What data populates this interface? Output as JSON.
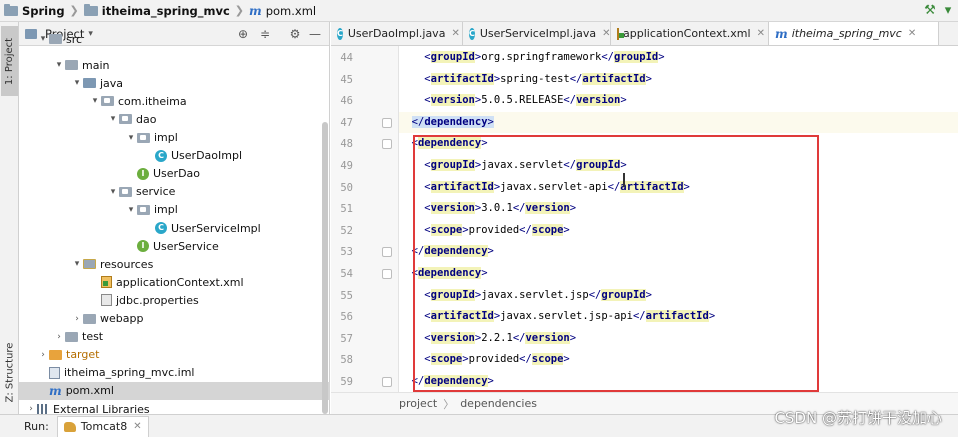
{
  "breadcrumb": {
    "items": [
      {
        "label": "Spring",
        "icon": "folder-icon"
      },
      {
        "label": "itheima_spring_mvc",
        "icon": "folder-icon"
      },
      {
        "label": "pom.xml",
        "icon": "maven-m-icon"
      }
    ]
  },
  "sidebar_strip": {
    "project_tab": "1: Project",
    "structure_tab": "Z: Structure",
    "bottom_tab": "tes"
  },
  "project_panel": {
    "title": "Project",
    "tree": [
      {
        "label": "src",
        "icon": "folder-icon",
        "level": 0,
        "expanded": true,
        "partial": true
      },
      {
        "label": "main",
        "icon": "folder-icon",
        "level": 1,
        "expanded": true
      },
      {
        "label": "java",
        "icon": "source-folder-icon",
        "level": 2,
        "expanded": true
      },
      {
        "label": "com.itheima",
        "icon": "package-icon",
        "level": 3,
        "expanded": true
      },
      {
        "label": "dao",
        "icon": "package-icon",
        "level": 4,
        "expanded": true
      },
      {
        "label": "impl",
        "icon": "package-icon",
        "level": 5,
        "expanded": true
      },
      {
        "label": "UserDaoImpl",
        "icon": "class-icon",
        "level": 6
      },
      {
        "label": "UserDao",
        "icon": "interface-icon",
        "level": 5
      },
      {
        "label": "service",
        "icon": "package-icon",
        "level": 4,
        "expanded": true
      },
      {
        "label": "impl",
        "icon": "package-icon",
        "level": 5,
        "expanded": true
      },
      {
        "label": "UserServiceImpl",
        "icon": "class-icon",
        "level": 6
      },
      {
        "label": "UserService",
        "icon": "interface-icon",
        "level": 5
      },
      {
        "label": "resources",
        "icon": "resources-folder-icon",
        "level": 2,
        "expanded": true
      },
      {
        "label": "applicationContext.xml",
        "icon": "spring-xml-icon",
        "level": 3
      },
      {
        "label": "jdbc.properties",
        "icon": "properties-icon",
        "level": 3
      },
      {
        "label": "webapp",
        "icon": "folder-icon",
        "level": 2,
        "expanded": false
      },
      {
        "label": "test",
        "icon": "folder-icon",
        "level": 1,
        "expanded": false
      },
      {
        "label": "target",
        "icon": "orange-folder-icon",
        "level": 0,
        "expanded": false
      },
      {
        "label": "itheima_spring_mvc.iml",
        "icon": "iml-file-icon",
        "level": 0
      },
      {
        "label": "pom.xml",
        "icon": "maven-m-icon",
        "level": 0,
        "selected": true
      },
      {
        "label": "External Libraries",
        "icon": "library-icon",
        "level": -1,
        "expanded": false
      }
    ]
  },
  "editor_tabs": [
    {
      "label": "UserDaoImpl.java",
      "icon": "class-icon",
      "active": false
    },
    {
      "label": "UserServiceImpl.java",
      "icon": "class-icon",
      "active": false
    },
    {
      "label": "applicationContext.xml",
      "icon": "spring-xml-icon",
      "active": false
    },
    {
      "label": "itheima_spring_mvc",
      "icon": "maven-m-icon",
      "active": true
    }
  ],
  "editor": {
    "lines": [
      {
        "n": "44",
        "indent": 2,
        "tag": "groupId",
        "text": "org.springframework"
      },
      {
        "n": "45",
        "indent": 2,
        "tag": "artifactId",
        "text": "spring-test"
      },
      {
        "n": "46",
        "indent": 2,
        "tag": "version",
        "text": "5.0.5.RELEASE"
      },
      {
        "n": "47",
        "indent": 1,
        "close": "dependency",
        "current": true
      },
      {
        "n": "48",
        "indent": 1,
        "open": "dependency"
      },
      {
        "n": "49",
        "indent": 2,
        "tag": "groupId",
        "text": "javax.servlet"
      },
      {
        "n": "50",
        "indent": 2,
        "tag": "artifactId",
        "text": "javax.servlet-api"
      },
      {
        "n": "51",
        "indent": 2,
        "tag": "version",
        "text": "3.0.1"
      },
      {
        "n": "52",
        "indent": 2,
        "tag": "scope",
        "text": "provided"
      },
      {
        "n": "53",
        "indent": 1,
        "close": "dependency"
      },
      {
        "n": "54",
        "indent": 1,
        "open": "dependency"
      },
      {
        "n": "55",
        "indent": 2,
        "tag": "groupId",
        "text": "javax.servlet.jsp"
      },
      {
        "n": "56",
        "indent": 2,
        "tag": "artifactId",
        "text": "javax.servlet.jsp-api"
      },
      {
        "n": "57",
        "indent": 2,
        "tag": "version",
        "text": "2.2.1"
      },
      {
        "n": "58",
        "indent": 2,
        "tag": "scope",
        "text": "provided"
      },
      {
        "n": "59",
        "indent": 1,
        "close": "dependency"
      }
    ],
    "breadcrumb": [
      "project",
      "dependencies"
    ]
  },
  "run_bar": {
    "label": "Run:",
    "tab": "Tomcat8"
  },
  "watermark": "CSDN @苏打饼干没加心",
  "colors": {
    "tag": "#000080",
    "highlight_box": "#e03a3a",
    "selection": "#d5d5d5"
  }
}
